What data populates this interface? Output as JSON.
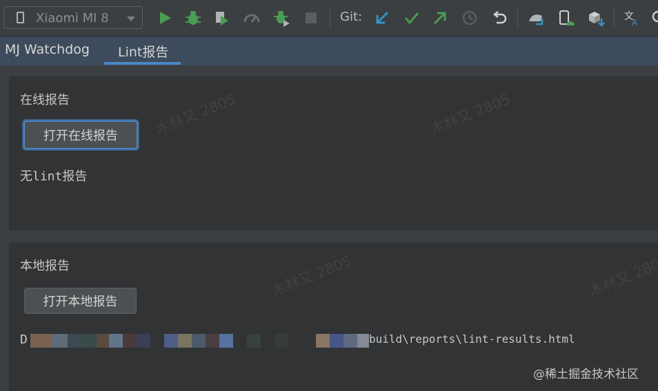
{
  "toolbar": {
    "device_label": "Xiaomi MI 8",
    "git_label": "Git:",
    "icons": [
      "phone-icon",
      "run-icon",
      "debug-icon",
      "coverage-icon",
      "profile-icon",
      "attach-debugger-icon",
      "stop-icon",
      "git-update-icon",
      "git-commit-icon",
      "git-push-icon",
      "history-icon",
      "rollback-icon",
      "sync-gradle-icon",
      "device-manager-icon",
      "sdk-manager-icon",
      "translate-icon",
      "search-icon"
    ]
  },
  "tabs": [
    {
      "label": "MJ Watchdog",
      "active": false
    },
    {
      "label": "Lint报告",
      "active": true
    }
  ],
  "online": {
    "title": "在线报告",
    "button": "打开在线报告",
    "status": "无lint报告"
  },
  "local": {
    "title": "本地报告",
    "button": "打开本地报告",
    "path_prefix": "D",
    "path_suffix": "build\\reports\\lint-results.html"
  },
  "watermark": {
    "text": "木林又 2805",
    "footer": "@稀土掘金技术社区"
  },
  "colors": {
    "accent": "#4a88c7",
    "run_green": "#499c54",
    "git_blue": "#3592c4"
  }
}
